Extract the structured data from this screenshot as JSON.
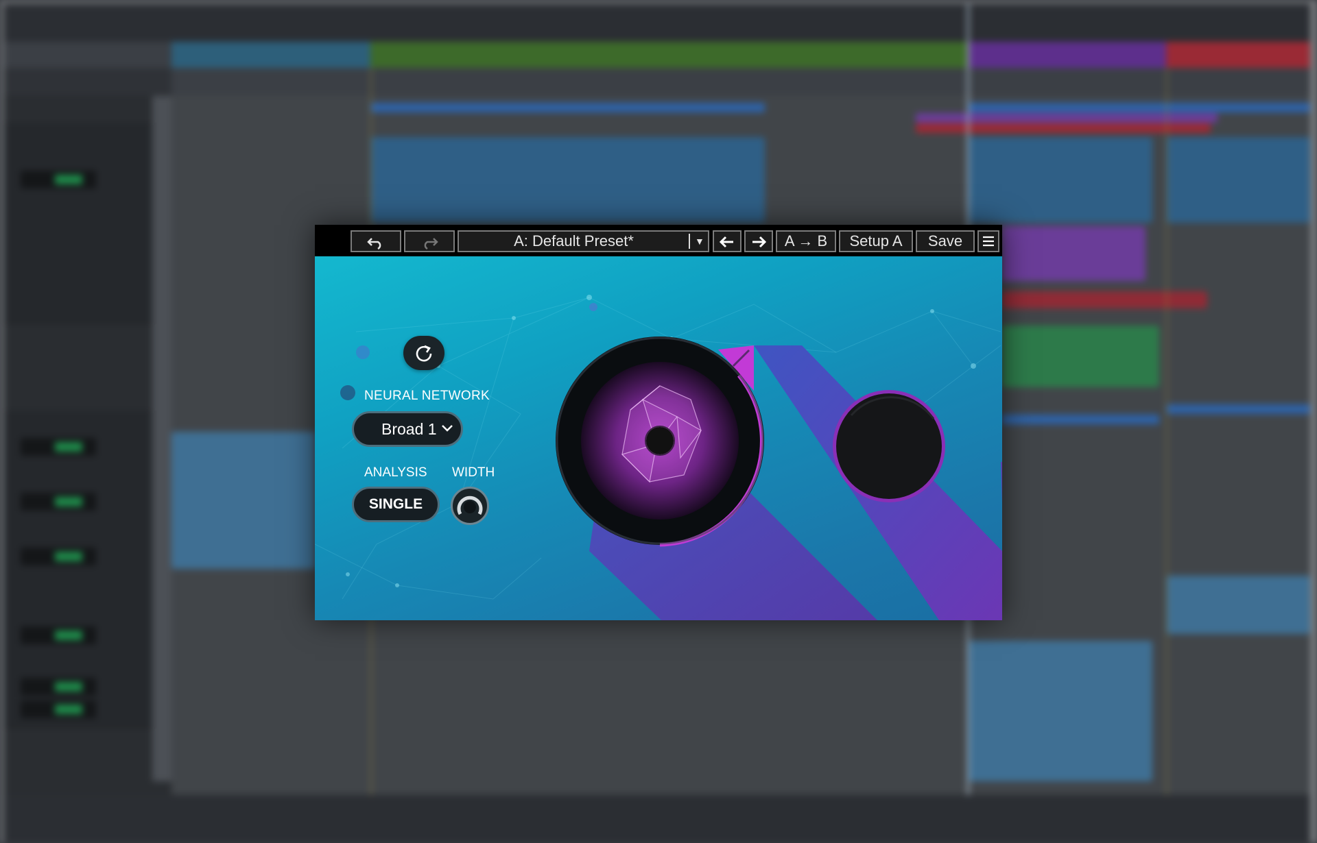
{
  "toolbar": {
    "undo_icon": "undo-icon",
    "redo_icon": "redo-icon",
    "preset_name": "A: Default Preset*",
    "preset_dropdown_icon": "caret-down-icon",
    "prev_preset_icon": "arrow-left-icon",
    "next_preset_icon": "arrow-right-icon",
    "ab_label": "A → B",
    "setup_label": "Setup A",
    "save_label": "Save",
    "menu_icon": "hamburger-icon"
  },
  "controls": {
    "reset_icon": "reset-icon",
    "neural_network_label": "NEURAL NETWORK",
    "neural_network_value": "Broad 1",
    "analysis_label": "ANALYSIS",
    "analysis_value": "SINGLE",
    "width_label": "WIDTH"
  },
  "colors": {
    "accent_magenta": "#c23ad6",
    "panel_cyan": "#14b8cf",
    "panel_blue": "#1a6ea3",
    "diagonal_purple": "#5a3fb0",
    "button_dark": "#161e23"
  }
}
